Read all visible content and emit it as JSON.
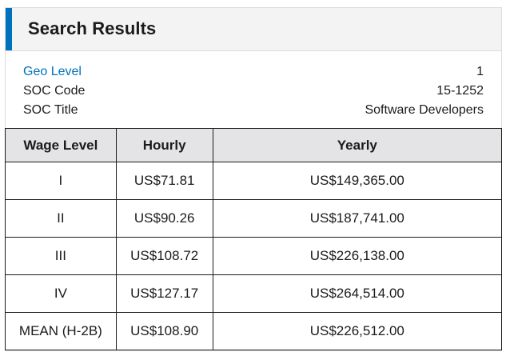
{
  "panel": {
    "title": "Search Results",
    "accent_color": "#0071bc",
    "link_color": "#0071bc"
  },
  "meta": [
    {
      "label": "Geo Level",
      "value": "1",
      "link": true
    },
    {
      "label": "SOC Code",
      "value": "15-1252",
      "link": false
    },
    {
      "label": "SOC Title",
      "value": "Software Developers",
      "link": false
    }
  ],
  "table": {
    "headers": [
      "Wage Level",
      "Hourly",
      "Yearly"
    ],
    "rows": [
      [
        "I",
        "US$71.81",
        "US$149,365.00"
      ],
      [
        "II",
        "US$90.26",
        "US$187,741.00"
      ],
      [
        "III",
        "US$108.72",
        "US$226,138.00"
      ],
      [
        "IV",
        "US$127.17",
        "US$264,514.00"
      ],
      [
        "MEAN (H-2B)",
        "US$108.90",
        "US$226,512.00"
      ]
    ]
  }
}
